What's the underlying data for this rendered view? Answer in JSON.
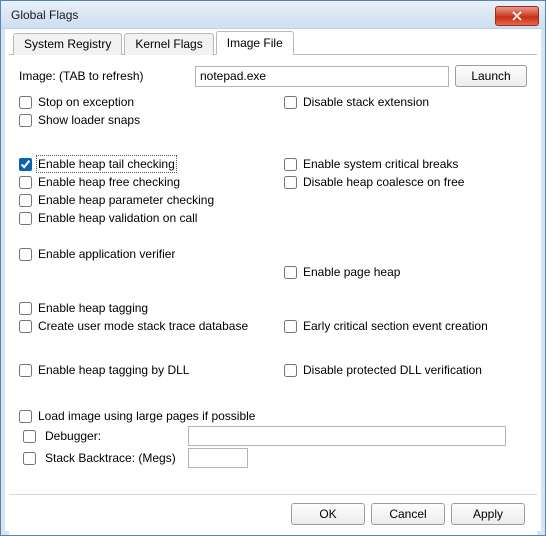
{
  "window": {
    "title": "Global Flags"
  },
  "tabs": [
    {
      "label": "System Registry"
    },
    {
      "label": "Kernel Flags"
    },
    {
      "label": "Image File"
    }
  ],
  "activeTab": 2,
  "imageRow": {
    "label": "Image: (TAB to refresh)",
    "value": "notepad.exe",
    "launch": "Launch"
  },
  "opts": {
    "stop_on_exception": "Stop on exception",
    "show_loader_snaps": "Show loader snaps",
    "disable_stack_extension": "Disable stack extension",
    "heap_tail_checking": "Enable heap tail checking",
    "heap_free_checking": "Enable heap free checking",
    "heap_parameter_checking": "Enable heap parameter checking",
    "heap_validation_on_call": "Enable heap validation on call",
    "system_critical_breaks": "Enable system critical breaks",
    "disable_heap_coalesce": "Disable heap coalesce on free",
    "application_verifier": "Enable application verifier",
    "page_heap": "Enable page heap",
    "heap_tagging": "Enable heap tagging",
    "user_mode_stack_trace": "Create user mode stack trace database",
    "early_critical_section": "Early critical section event creation",
    "heap_tagging_by_dll": "Enable heap tagging by DLL",
    "disable_protected_dll": "Disable protected DLL verification",
    "large_pages": "Load image using large pages if possible",
    "debugger": "Debugger:",
    "stack_backtrace": "Stack Backtrace: (Megs)"
  },
  "checked": {
    "heap_tail_checking": true
  },
  "fields": {
    "debugger_value": "",
    "stack_backtrace_value": ""
  },
  "buttons": {
    "ok": "OK",
    "cancel": "Cancel",
    "apply": "Apply"
  }
}
